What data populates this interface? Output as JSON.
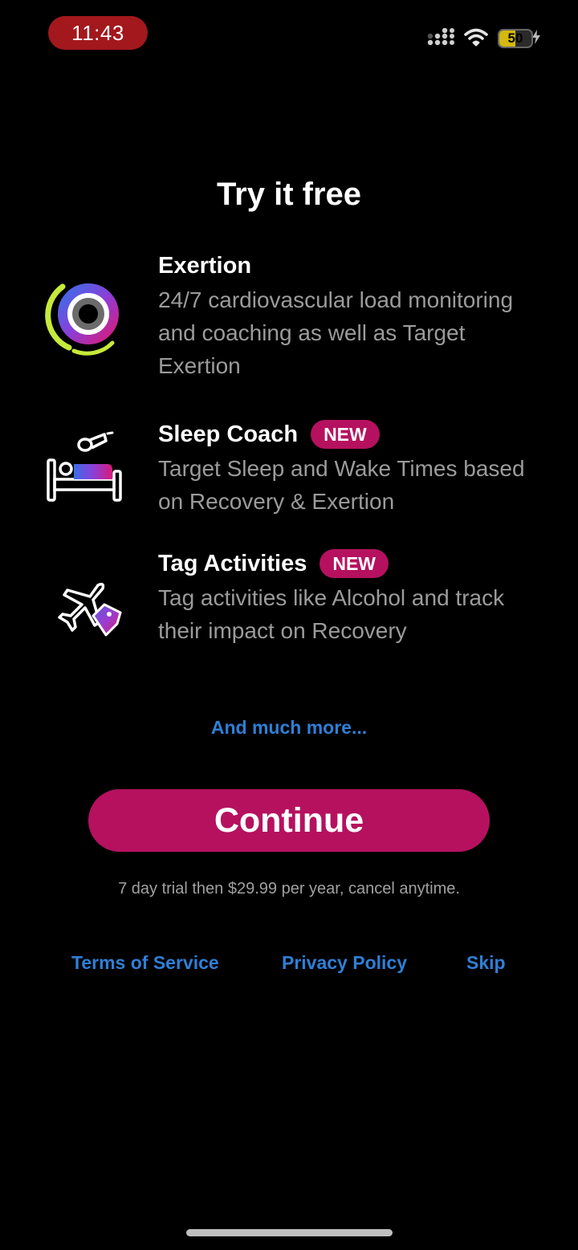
{
  "status_bar": {
    "time": "11:43",
    "battery": "50",
    "battery_level": 0.5,
    "signal_icon": "cellular-signal-icon",
    "wifi_icon": "wifi-icon",
    "charging_icon": "bolt-icon"
  },
  "screen": {
    "title": "Try it free"
  },
  "features": [
    {
      "title": "Exertion",
      "badge": "",
      "description": "24/7 cardiovascular load monitoring and coaching as well as Target Exertion",
      "icon": "exertion-ring-icon"
    },
    {
      "title": "Sleep Coach",
      "badge": "NEW",
      "description": "Target Sleep and Wake Times based on Recovery & Exertion",
      "icon": "bed-alarm-icon"
    },
    {
      "title": "Tag Activities",
      "badge": "NEW",
      "description": "Tag activities like Alcohol and track their impact on Recovery",
      "icon": "airplane-tag-icon"
    }
  ],
  "more_link": "And much more...",
  "continue_button": "Continue",
  "trial_text": "7 day trial then $29.99 per year, cancel anytime.",
  "footer": {
    "terms": "Terms of Service",
    "privacy": "Privacy Policy",
    "skip": "Skip"
  },
  "colors": {
    "accent": "#b5115f",
    "link": "#2f7fd6",
    "background": "#000000",
    "status_time_bg": "#a3181d",
    "battery": "#d4b90f"
  }
}
